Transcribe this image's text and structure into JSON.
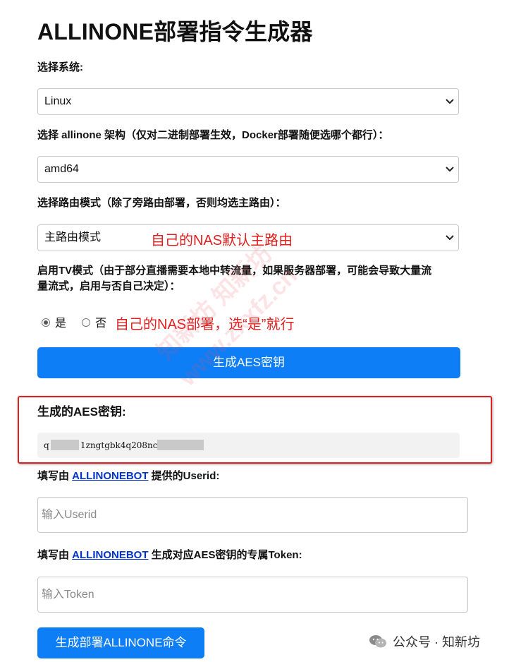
{
  "page": {
    "title": "ALLINONE部署指令生成器"
  },
  "system": {
    "label": "选择系统:",
    "selected": "Linux"
  },
  "arch": {
    "label": "选择 allinone 架构（仅对二进制部署生效，Docker部署随便选哪个都行）：",
    "selected": "amd64"
  },
  "route": {
    "label": "选择路由模式（除了旁路由部署，否则均选主路由）：",
    "selected": "主路由模式",
    "annotation": "自己的NAS默认主路由"
  },
  "tv": {
    "label_line1": "启用TV模式（由于部分直播需要本地中转流量，如果服务器部署，可能会导致大量流",
    "label_line2": "量流式，启用与否自己决定）：",
    "option_yes": "是",
    "option_no": "否",
    "selected": "是",
    "annotation": "自己的NAS部署，选“是”就行"
  },
  "aes": {
    "button_label": "生成AES密钥",
    "result_label": "生成的AES密钥:",
    "key_prefix": "q",
    "key_visible": "1zngtgbk4q208nce"
  },
  "userid": {
    "label_prefix": "填写由 ",
    "link_text": "ALLINONEBOT",
    "label_suffix": " 提供的Userid:",
    "placeholder": "输入Userid"
  },
  "token": {
    "label_prefix": "填写由 ",
    "link_text": "ALLINONEBOT",
    "label_suffix": " 生成对应AES密钥的专属Token:",
    "placeholder": "输入Token"
  },
  "generate": {
    "button_label": "生成部署ALLINONE命令"
  },
  "watermark": {
    "line1": "知新坊 知新坊",
    "line2": "www.zxxfz.cn"
  },
  "brand": {
    "text": "公众号 · 知新坊"
  },
  "colors": {
    "primary_button": "#0d7ef6",
    "annotation": "#e02020",
    "link": "#0033cc"
  }
}
